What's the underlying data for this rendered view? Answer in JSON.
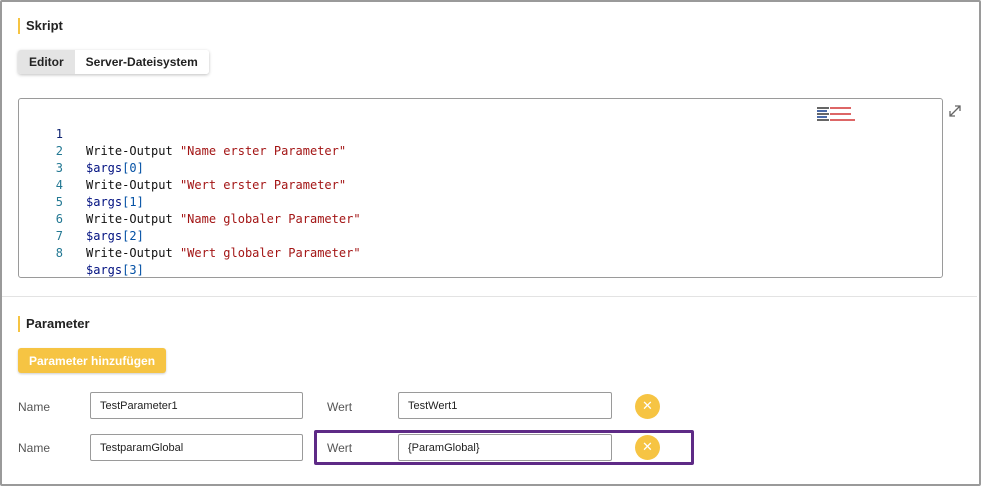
{
  "script_section": {
    "title": "Skript",
    "tabs": [
      {
        "label": "Editor",
        "active": true
      },
      {
        "label": "Server-Dateisystem",
        "active": false
      }
    ]
  },
  "editor": {
    "lines": [
      {
        "num": "1",
        "cmd": "Write-Output",
        "arg": "\"Name erster Parameter\""
      },
      {
        "num": "2",
        "var": "$args",
        "open": "[",
        "idx": "0",
        "close": "]"
      },
      {
        "num": "3",
        "cmd": "Write-Output",
        "arg": "\"Wert erster Parameter\""
      },
      {
        "num": "4",
        "var": "$args",
        "open": "[",
        "idx": "1",
        "close": "]"
      },
      {
        "num": "5",
        "cmd": "Write-Output",
        "arg": "\"Name globaler Parameter\""
      },
      {
        "num": "6",
        "var": "$args",
        "open": "[",
        "idx": "2",
        "close": "]"
      },
      {
        "num": "7",
        "cmd": "Write-Output",
        "arg": "\"Wert globaler Parameter\""
      },
      {
        "num": "8",
        "var": "$args",
        "open": "[",
        "idx": "3",
        "close": "]"
      }
    ],
    "expand_icon": "expand-diagonal-icon"
  },
  "parameter_section": {
    "title": "Parameter",
    "add_button_label": "Parameter hinzufügen",
    "rows": [
      {
        "name_label": "Name",
        "name_value": "TestParameter1",
        "value_label": "Wert",
        "value_value": "TestWert1",
        "remove_icon": "close-icon"
      },
      {
        "name_label": "Name",
        "name_value": "TestparamGlobal",
        "value_label": "Wert",
        "value_value": "{ParamGlobal}",
        "remove_icon": "close-icon"
      }
    ]
  },
  "colors": {
    "accent": "#f6c443",
    "highlight_border": "#5e2a86",
    "string": "#a31515",
    "variable": "#001080",
    "line_number": "#237893"
  }
}
